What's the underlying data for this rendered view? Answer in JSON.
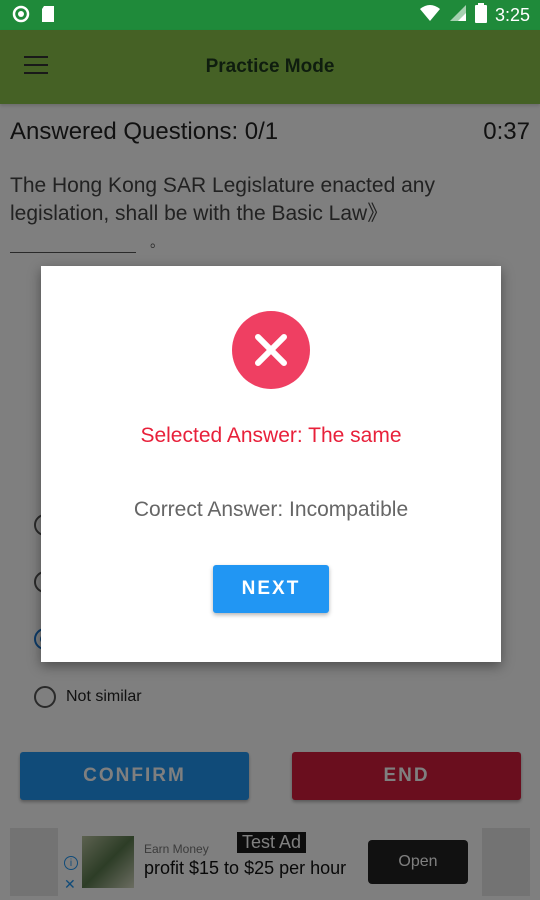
{
  "status_bar": {
    "time": "3:25",
    "icons": [
      "circle-icon",
      "sd-card-icon",
      "wifi-icon",
      "signal-icon",
      "battery-icon"
    ]
  },
  "app_bar": {
    "title": "Practice Mode",
    "menu_icon": "hamburger-menu-icon"
  },
  "quiz": {
    "answered_label": "Answered Questions: 0/1",
    "timer": "0:37",
    "question": "The Hong Kong SAR Legislature enacted any legislation, shall be with the Basic Law》",
    "blank_suffix": "。",
    "options": [
      {
        "label": "",
        "selected": false
      },
      {
        "label": "",
        "selected": false
      },
      {
        "label": "",
        "selected": true
      },
      {
        "label": "Not similar",
        "selected": false
      }
    ]
  },
  "buttons": {
    "confirm": "CONFIRM",
    "end": "END"
  },
  "ad": {
    "tag": "Test Ad",
    "small_text": "Earn Money",
    "text": "profit $15 to $25 per hour",
    "open": "Open",
    "info": "i",
    "close": "✕"
  },
  "dialog": {
    "icon": "error-x-icon",
    "selected_answer": "Selected Answer: The same",
    "correct_answer": "Correct Answer: Incompatible",
    "next": "NEXT"
  },
  "colors": {
    "status_bar": "#1f8a3a",
    "app_bar": "#8bc34a",
    "primary": "#2196f3",
    "end": "#d41c3c",
    "error": "#ef3f62",
    "selected_text": "#e8203a"
  }
}
